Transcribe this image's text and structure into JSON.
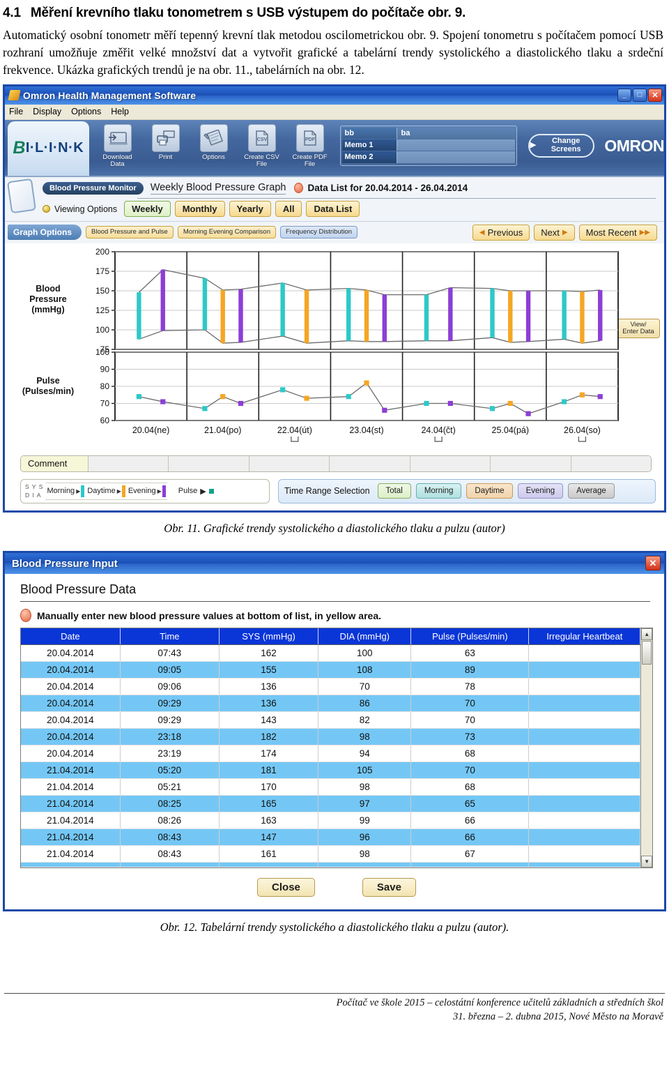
{
  "document": {
    "heading_number": "4.1",
    "heading_text": "Měření krevního tlaku tonometrem s USB výstupem do počítače obr. 9.",
    "paragraph": "Automatický osobní tonometr měří tepenný krevní tlak metodou oscilometrickou obr. 9.  Spojení tonometru s počítačem pomocí USB rozhraní umožňuje změřit velké množství dat a vytvořit grafické a tabelární trendy systolického a diastolického tlaku a srdeční frekvence. Ukázka grafických trendů je na obr. 11., tabelárních na obr. 12.",
    "caption_fig11": "Obr. 11. Grafické trendy systolického a diastolického tlaku a pulzu (autor)",
    "caption_fig12": "Obr. 12. Tabelární trendy systolického a diastolického tlaku a pulzu (autor).",
    "footer_line1": "Počítač ve škole 2015 – celostátní konference učitelů základních a středních škol",
    "footer_line2": "31. března – 2. dubna 2015, Nové Město na Moravě"
  },
  "window1": {
    "title": "Omron Health Management Software",
    "title_icon": "app-icon",
    "buttons": {
      "minimize": "_",
      "maximize": "□",
      "close": "✕"
    },
    "menu": [
      "File",
      "Display",
      "Options",
      "Help"
    ],
    "brand_logo": {
      "b": "B",
      "rest": "I·L·I·N·K"
    },
    "toolbar_items": [
      {
        "label": "Download Data",
        "icon": "download-icon",
        "glyph": ""
      },
      {
        "label": "Print",
        "icon": "printer-icon",
        "glyph": ""
      },
      {
        "label": "Options",
        "icon": "wrench-icon",
        "glyph": ""
      },
      {
        "label": "Create CSV File",
        "icon": "csv-file-icon",
        "glyph": "CSV"
      },
      {
        "label": "Create PDF File",
        "icon": "pdf-file-icon",
        "glyph": "PDF"
      }
    ],
    "memo": {
      "rows": [
        {
          "key": "bb",
          "value": "ba"
        },
        {
          "key": "Memo 1",
          "value": ""
        },
        {
          "key": "Memo 2",
          "value": ""
        }
      ]
    },
    "change_screens": "Change Screens",
    "omron_logo": "OMRON",
    "nav": {
      "monitor_pill": "Blood Pressure Monitor",
      "graph_title": "Weekly Blood Pressure Graph",
      "data_list_for": "Data List for 20.04.2014 - 26.04.2014",
      "viewing_options_label": "Viewing Options",
      "view_tabs": [
        {
          "label": "Weekly",
          "active": true
        },
        {
          "label": "Monthly",
          "active": false
        },
        {
          "label": "Yearly",
          "active": false
        },
        {
          "label": "All",
          "active": false
        },
        {
          "label": "Data List",
          "active": false
        }
      ],
      "graph_options_label": "Graph Options",
      "graph_option_buttons": [
        {
          "label": "Blood Pressure and Pulse",
          "style": "yellow"
        },
        {
          "label": "Morning Evening Comparison",
          "style": "yellow"
        },
        {
          "label": "Frequency Distribution",
          "style": "blue"
        }
      ],
      "nav_buttons": [
        {
          "label": "Previous",
          "arrow": "left"
        },
        {
          "label": "Next",
          "arrow": "right"
        },
        {
          "label": "Most Recent",
          "arrow": "double-right"
        }
      ]
    },
    "view_enter_data_button": "View/ Enter Data",
    "comment_label": "Comment",
    "legend": {
      "sys": "S Y S",
      "dia": "D I A",
      "items": [
        {
          "label": "Morning",
          "color": "#2ec8c8"
        },
        {
          "label": "Daytime",
          "color": "#f5a623"
        },
        {
          "label": "Evening",
          "color": "#8c3ed6"
        }
      ],
      "pulse_label": "Pulse",
      "pulse_color": "#17a08a"
    },
    "time_range": {
      "label": "Time Range Selection",
      "buttons": [
        "Total",
        "Morning",
        "Daytime",
        "Evening",
        "Average"
      ]
    }
  },
  "chart_data": {
    "type": "line",
    "title": "Weekly Blood Pressure Graph",
    "ylabel_top": "Blood Pressure (mmHg)",
    "ylabel_bottom": "Pulse (Pulses/min)",
    "xlabel": "",
    "grid": true,
    "legend_position": "bottom-left",
    "bp_ticks": [
      200,
      175,
      150,
      125,
      100,
      75
    ],
    "bp_ylim": [
      75,
      200
    ],
    "pulse_ticks": [
      100,
      90,
      80,
      70,
      60
    ],
    "pulse_ylim": [
      60,
      100
    ],
    "categories": [
      "20.04(ne)",
      "21.04(po)",
      "22.04(út)",
      "23.04(st)",
      "24.04(čt)",
      "25.04(pá)",
      "26.04(so)"
    ],
    "series": [
      {
        "name": "Blood Pressure bars (SYS top, DIA bottom)",
        "points": [
          {
            "day": "20.04(ne)",
            "slot": 0,
            "period": "Morning",
            "color": "#2ec8c8",
            "sys": 148,
            "dia": 88
          },
          {
            "day": "20.04(ne)",
            "slot": 1,
            "period": "Evening",
            "color": "#8c3ed6",
            "sys": 177,
            "dia": 99
          },
          {
            "day": "21.04(po)",
            "slot": 0,
            "period": "Morning",
            "color": "#2ec8c8",
            "sys": 166,
            "dia": 100
          },
          {
            "day": "21.04(po)",
            "slot": 1,
            "period": "Daytime",
            "color": "#f5a623",
            "sys": 151,
            "dia": 83
          },
          {
            "day": "21.04(po)",
            "slot": 2,
            "period": "Evening",
            "color": "#8c3ed6",
            "sys": 152,
            "dia": 84
          },
          {
            "day": "22.04(út)",
            "slot": 0,
            "period": "Morning",
            "color": "#2ec8c8",
            "sys": 160,
            "dia": 92
          },
          {
            "day": "22.04(út)",
            "slot": 1,
            "period": "Daytime",
            "color": "#f5a623",
            "sys": 151,
            "dia": 83
          },
          {
            "day": "23.04(st)",
            "slot": 0,
            "period": "Morning",
            "color": "#2ec8c8",
            "sys": 153,
            "dia": 86
          },
          {
            "day": "23.04(st)",
            "slot": 1,
            "period": "Daytime",
            "color": "#f5a623",
            "sys": 151,
            "dia": 85
          },
          {
            "day": "23.04(st)",
            "slot": 2,
            "period": "Evening",
            "color": "#8c3ed6",
            "sys": 145,
            "dia": 85
          },
          {
            "day": "24.04(čt)",
            "slot": 0,
            "period": "Morning",
            "color": "#2ec8c8",
            "sys": 145,
            "dia": 86
          },
          {
            "day": "24.04(čt)",
            "slot": 1,
            "period": "Evening",
            "color": "#8c3ed6",
            "sys": 154,
            "dia": 86
          },
          {
            "day": "25.04(pá)",
            "slot": 0,
            "period": "Morning",
            "color": "#2ec8c8",
            "sys": 153,
            "dia": 90
          },
          {
            "day": "25.04(pá)",
            "slot": 1,
            "period": "Daytime",
            "color": "#f5a623",
            "sys": 150,
            "dia": 84
          },
          {
            "day": "25.04(pá)",
            "slot": 2,
            "period": "Evening",
            "color": "#8c3ed6",
            "sys": 150,
            "dia": 85
          },
          {
            "day": "26.04(so)",
            "slot": 0,
            "period": "Morning",
            "color": "#2ec8c8",
            "sys": 150,
            "dia": 88
          },
          {
            "day": "26.04(so)",
            "slot": 1,
            "period": "Daytime",
            "color": "#f5a623",
            "sys": 149,
            "dia": 83
          },
          {
            "day": "26.04(so)",
            "slot": 2,
            "period": "Evening",
            "color": "#8c3ed6",
            "sys": 151,
            "dia": 86
          }
        ]
      },
      {
        "name": "Pulse",
        "points": [
          {
            "day": "20.04(ne)",
            "slot": 0,
            "period": "Morning",
            "color": "#2ec8c8",
            "pulse": 74
          },
          {
            "day": "20.04(ne)",
            "slot": 1,
            "period": "Evening",
            "color": "#8c3ed6",
            "pulse": 71
          },
          {
            "day": "21.04(po)",
            "slot": 0,
            "period": "Morning",
            "color": "#2ec8c8",
            "pulse": 67
          },
          {
            "day": "21.04(po)",
            "slot": 1,
            "period": "Daytime",
            "color": "#f5a623",
            "pulse": 74
          },
          {
            "day": "21.04(po)",
            "slot": 2,
            "period": "Evening",
            "color": "#8c3ed6",
            "pulse": 70
          },
          {
            "day": "22.04(út)",
            "slot": 0,
            "period": "Morning",
            "color": "#2ec8c8",
            "pulse": 78
          },
          {
            "day": "22.04(út)",
            "slot": 1,
            "period": "Daytime",
            "color": "#f5a623",
            "pulse": 73
          },
          {
            "day": "23.04(st)",
            "slot": 0,
            "period": "Morning",
            "color": "#2ec8c8",
            "pulse": 74
          },
          {
            "day": "23.04(st)",
            "slot": 1,
            "period": "Daytime",
            "color": "#f5a623",
            "pulse": 82
          },
          {
            "day": "23.04(st)",
            "slot": 2,
            "period": "Evening",
            "color": "#8c3ed6",
            "pulse": 66
          },
          {
            "day": "24.04(čt)",
            "slot": 0,
            "period": "Morning",
            "color": "#2ec8c8",
            "pulse": 70
          },
          {
            "day": "24.04(čt)",
            "slot": 1,
            "period": "Evening",
            "color": "#8c3ed6",
            "pulse": 70
          },
          {
            "day": "25.04(pá)",
            "slot": 0,
            "period": "Morning",
            "color": "#2ec8c8",
            "pulse": 67
          },
          {
            "day": "25.04(pá)",
            "slot": 1,
            "period": "Daytime",
            "color": "#f5a623",
            "pulse": 70
          },
          {
            "day": "25.04(pá)",
            "slot": 2,
            "period": "Evening",
            "color": "#8c3ed6",
            "pulse": 64
          },
          {
            "day": "26.04(so)",
            "slot": 0,
            "period": "Morning",
            "color": "#2ec8c8",
            "pulse": 71
          },
          {
            "day": "26.04(so)",
            "slot": 1,
            "period": "Daytime",
            "color": "#f5a623",
            "pulse": 75
          },
          {
            "day": "26.04(so)",
            "slot": 2,
            "period": "Evening",
            "color": "#8c3ed6",
            "pulse": 74
          }
        ]
      }
    ]
  },
  "window2": {
    "title": "Blood Pressure Input",
    "close_label": "✕",
    "section_title": "Blood Pressure Data",
    "hint": "Manually enter new blood pressure values at bottom of list, in yellow area.",
    "table": {
      "columns": [
        "Date",
        "Time",
        "SYS (mmHg)",
        "DIA (mmHg)",
        "Pulse (Pulses/min)",
        "Irregular Heartbeat"
      ],
      "rows": [
        [
          "20.04.2014",
          "07:43",
          "162",
          "100",
          "63",
          ""
        ],
        [
          "20.04.2014",
          "09:05",
          "155",
          "108",
          "89",
          ""
        ],
        [
          "20.04.2014",
          "09:06",
          "136",
          "70",
          "78",
          ""
        ],
        [
          "20.04.2014",
          "09:29",
          "136",
          "86",
          "70",
          ""
        ],
        [
          "20.04.2014",
          "09:29",
          "143",
          "82",
          "70",
          ""
        ],
        [
          "20.04.2014",
          "23:18",
          "182",
          "98",
          "73",
          ""
        ],
        [
          "20.04.2014",
          "23:19",
          "174",
          "94",
          "68",
          ""
        ],
        [
          "21.04.2014",
          "05:20",
          "181",
          "105",
          "70",
          ""
        ],
        [
          "21.04.2014",
          "05:21",
          "170",
          "98",
          "68",
          ""
        ],
        [
          "21.04.2014",
          "08:25",
          "165",
          "97",
          "65",
          ""
        ],
        [
          "21.04.2014",
          "08:26",
          "163",
          "99",
          "66",
          ""
        ],
        [
          "21.04.2014",
          "08:43",
          "147",
          "96",
          "66",
          ""
        ],
        [
          "21.04.2014",
          "08:43",
          "161",
          "98",
          "67",
          ""
        ]
      ]
    },
    "scrollbar": {
      "up": "▲",
      "down": "▼"
    },
    "actions": [
      "Close",
      "Save"
    ]
  }
}
